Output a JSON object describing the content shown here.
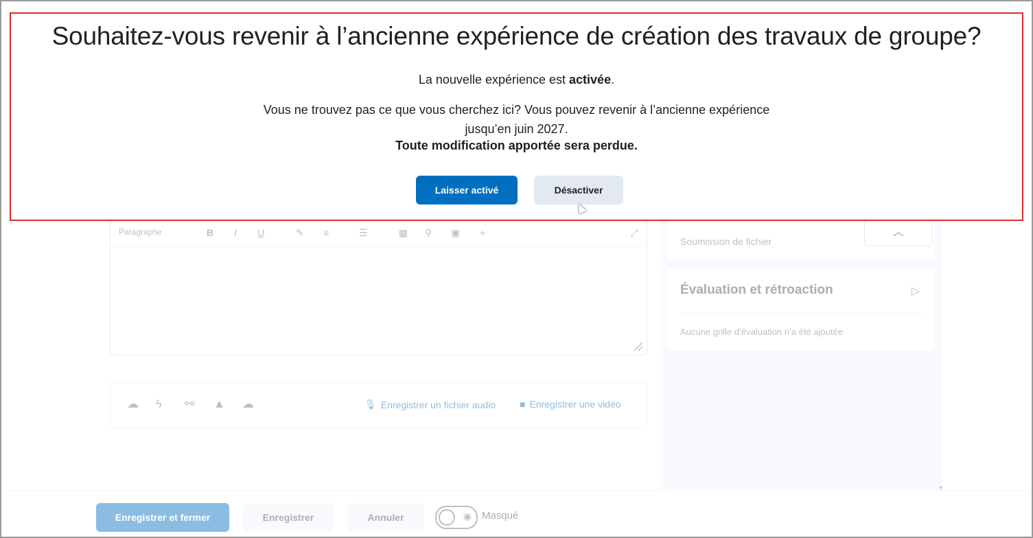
{
  "dialog": {
    "title": "Souhaitez-vous revenir à l’ancienne expérience de création des travaux de groupe?",
    "status_prefix": "La nouvelle expérience est ",
    "status_bold": "activée",
    "status_suffix": ".",
    "info_line1": "Vous ne trouvez pas ce que vous cherchez ici? Vous pouvez revenir à l’ancienne expérience",
    "info_line2": "jusqu’en juin 2027.",
    "warning": "Toute modification apportée sera perdue.",
    "keep_button": "Laisser activé",
    "disable_button": "Désactiver"
  },
  "editor": {
    "format_label": "Paragraphe",
    "record_audio": "Enregistrer un fichier audio",
    "record_video": "Enregistrer une vidéo"
  },
  "side": {
    "submission_type": "Soumission de fichier",
    "evaluation_title": "Évaluation et rétroaction",
    "evaluation_text": "Aucune grille d’évaluation n’a été ajoutée"
  },
  "footer": {
    "save_close": "Enregistrer et fermer",
    "save": "Enregistrer",
    "cancel": "Annuler",
    "visibility": "Masqué"
  },
  "colors": {
    "primary": "#006fbf",
    "highlight_border": "#d72b2b"
  }
}
